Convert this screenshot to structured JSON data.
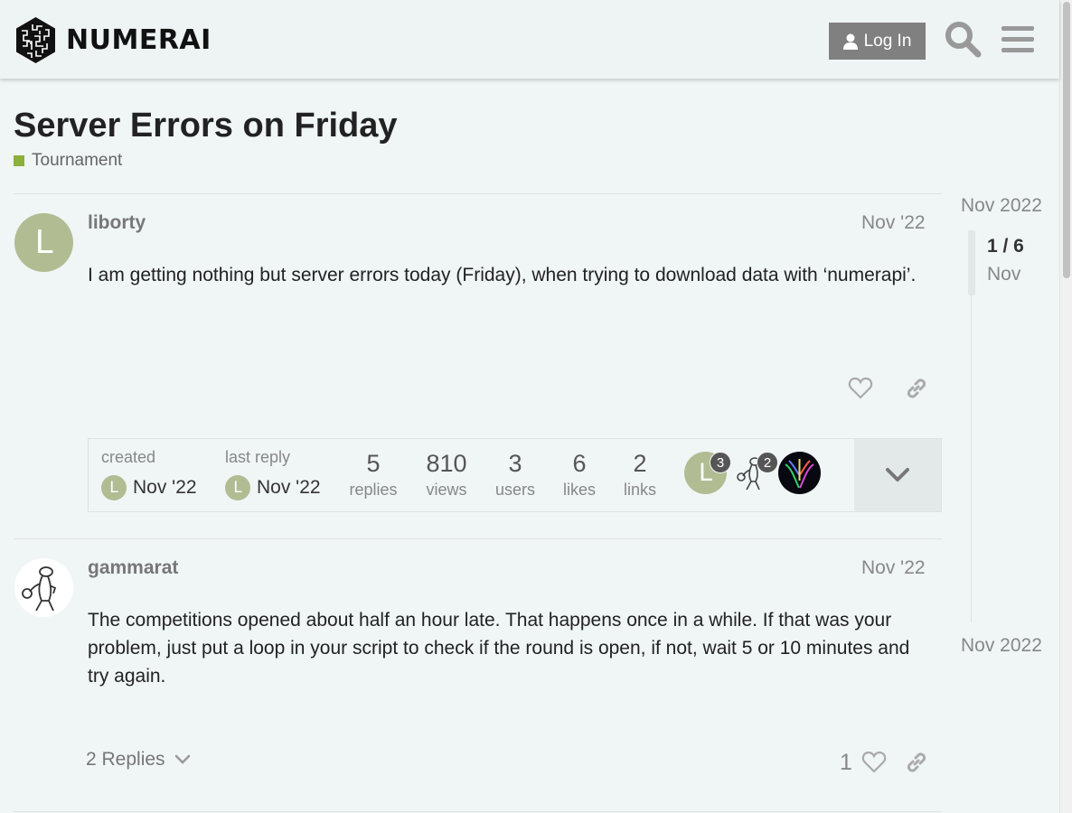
{
  "header": {
    "logo_text": "NUMERAI",
    "login_label": "Log In",
    "search_icon": "search-icon",
    "menu_icon": "hamburger-menu-icon"
  },
  "topic": {
    "title": "Server Errors on Friday",
    "category": "Tournament",
    "category_color": "#8bb03b"
  },
  "posts": [
    {
      "username": "liborty",
      "avatar_letter": "L",
      "date": "Nov '22",
      "body": "I am getting nothing but server errors today (Friday), when trying to download data with ‘numerapi’."
    },
    {
      "username": "gammarat",
      "date": "Nov '22",
      "body": "The competitions opened about half an hour late. That happens once in a while. If that was your problem, just put a loop in your script to check if the round is open, if not, wait 5 or 10 minutes and try again.",
      "replies_label": "2 Replies",
      "like_count": "1"
    }
  ],
  "topic_map": {
    "created_label": "created",
    "created_avatar": "L",
    "created_date": "Nov '22",
    "last_reply_label": "last reply",
    "last_reply_avatar": "L",
    "last_reply_date": "Nov '22",
    "stats": [
      {
        "value": "5",
        "label": "replies"
      },
      {
        "value": "810",
        "label": "views"
      },
      {
        "value": "3",
        "label": "users"
      },
      {
        "value": "6",
        "label": "likes"
      },
      {
        "value": "2",
        "label": "links"
      }
    ],
    "participants": [
      {
        "letter": "L",
        "count": "3"
      },
      {
        "letter": "",
        "count": "2"
      },
      {
        "letter": "",
        "count": ""
      }
    ]
  },
  "timeline": {
    "start_label": "Nov 2022",
    "position": "1 / 6",
    "position_date": "Nov",
    "end_label": "Nov 2022"
  }
}
